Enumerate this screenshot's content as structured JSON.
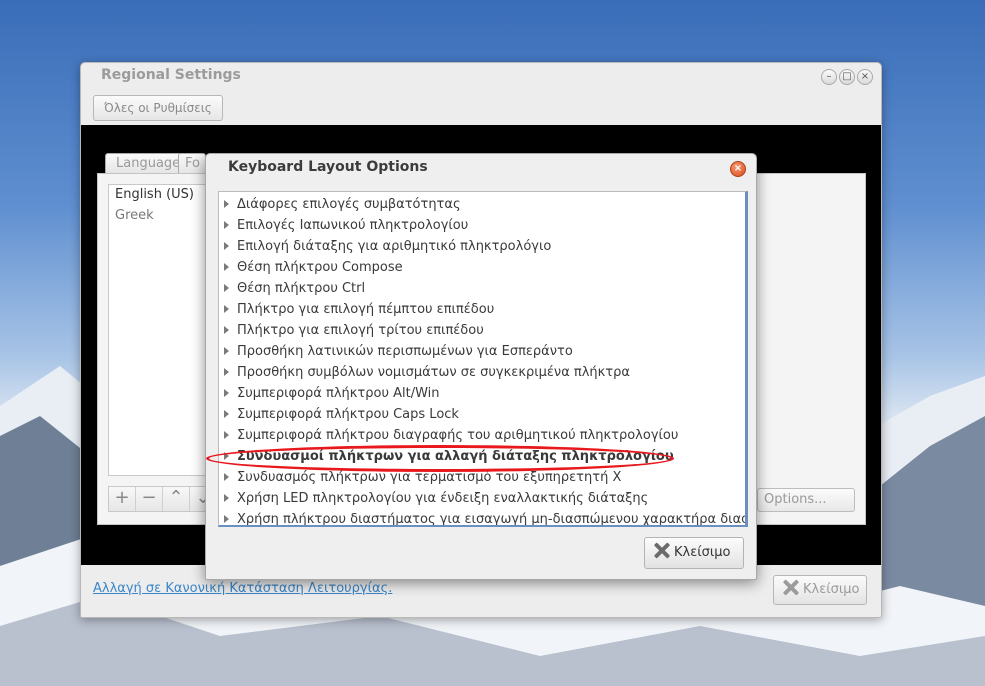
{
  "colors": {
    "accent_link": "#3a86c8",
    "highlight_ellipse": "#e8181c",
    "scrollbar": "#6c8fc2"
  },
  "regional_settings": {
    "title": "Regional Settings",
    "all_settings_label": "Όλες οι Ρυθμίσεις",
    "tabs": [
      {
        "label": "Language"
      },
      {
        "label": "Fo"
      }
    ],
    "languages": [
      "English (US)",
      "Greek"
    ],
    "toolbar": {
      "add": "+",
      "remove": "−",
      "up": "⌃",
      "down": "⌄"
    },
    "options_label": "Options...",
    "mode_link": "Αλλαγή  σε Κανονική Κατάσταση Λειτουργίας.",
    "close_label": "Κλείσιμο",
    "window_controls": {
      "minimize": "–",
      "maximize": "□",
      "close": "×"
    }
  },
  "keyboard_options": {
    "title": "Keyboard Layout Options",
    "items": [
      {
        "label": "Διάφορες επιλογές συμβατότητας"
      },
      {
        "label": "Επιλογές Ιαπωνικού πληκτρολογίου"
      },
      {
        "label": "Επιλογή διάταξης για αριθμητικό πληκτρολόγιο"
      },
      {
        "label": "Θέση πλήκτρου Compose"
      },
      {
        "label": "Θέση πλήκτρου Ctrl"
      },
      {
        "label": "Πλήκτρο για επιλογή πέμπτου επιπέδου"
      },
      {
        "label": "Πλήκτρο για επιλογή τρίτου επιπέδου"
      },
      {
        "label": "Προσθήκη λατινικών περισπωμένων για Εσπεράντο"
      },
      {
        "label": "Προσθήκη συμβόλων νομισμάτων σε συγκεκριμένα πλήκτρα"
      },
      {
        "label": "Συμπεριφορά πλήκτρου Alt/Win"
      },
      {
        "label": "Συμπεριφορά πλήκτρου Caps Lock"
      },
      {
        "label": "Συμπεριφορά πλήκτρου διαγραφής του αριθμητικού πληκτρολογίου"
      },
      {
        "label": "Συνδυασμοί πλήκτρων για αλλαγή διάταξης πληκτρολογίου",
        "highlighted": true
      },
      {
        "label": "Συνδυασμός πλήκτρων για τερματισμό του εξυπηρετητή X"
      },
      {
        "label": "Χρήση LED πληκτρολογίου για ένδειξη εναλλακτικής διάταξης"
      },
      {
        "label": "Χρήση πλήκτρου διαστήματος για εισαγωγή μη-διασπώμενου χαρακτήρα διαστήματος"
      }
    ],
    "close_label": "Κλείσιμο",
    "titlebar_close": "×"
  }
}
